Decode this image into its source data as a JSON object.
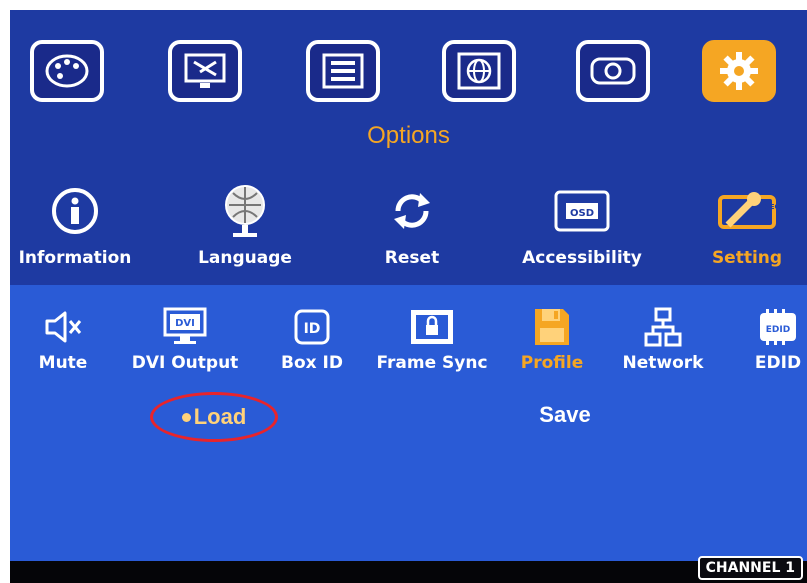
{
  "top_menu": {
    "title": "Options",
    "icons": [
      {
        "name": "palette-icon",
        "active": false
      },
      {
        "name": "monitor-tools-icon",
        "active": false
      },
      {
        "name": "sliders-icon",
        "active": false
      },
      {
        "name": "globe-icon",
        "active": false
      },
      {
        "name": "projector-icon",
        "active": false
      },
      {
        "name": "gear-icon",
        "active": true
      }
    ]
  },
  "options_menu": {
    "items": [
      {
        "label": "Information",
        "icon": "info-icon"
      },
      {
        "label": "Language",
        "icon": "globe-stand-icon"
      },
      {
        "label": "Reset",
        "icon": "reset-arrows-icon"
      },
      {
        "label": "Accessibility",
        "icon": "osd-icon"
      },
      {
        "label": "Setting",
        "icon": "wrench-geo-icon",
        "active": true
      }
    ]
  },
  "setting_menu": {
    "items": [
      {
        "label": "Mute",
        "icon": "speaker-mute-icon"
      },
      {
        "label": "DVI Output",
        "icon": "dvi-icon"
      },
      {
        "label": "Box ID",
        "icon": "id-icon"
      },
      {
        "label": "Frame Sync",
        "icon": "frame-lock-icon"
      },
      {
        "label": "Profile",
        "icon": "floppy-disk-icon",
        "active": true
      },
      {
        "label": "Network",
        "icon": "network-icon"
      },
      {
        "label": "EDID",
        "icon": "edid-icon"
      }
    ]
  },
  "profile_options": {
    "load_label": "Load",
    "save_label": "Save"
  },
  "status_bar": {
    "channel_label": "CHANNEL 1"
  },
  "colors": {
    "top_panel": "#1e3aa2",
    "bottom_panel": "#2a5bd6",
    "accent": "#f5a623",
    "highlight_circle": "#e8242b"
  }
}
